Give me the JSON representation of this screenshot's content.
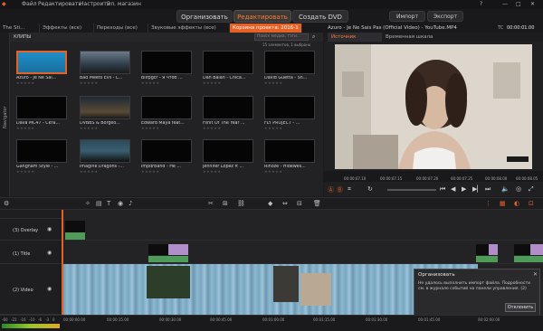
{
  "menu": [
    "Файл",
    "Редактировать",
    "Настроить",
    "Эл. магазин"
  ],
  "modes": {
    "organize": "Организовать",
    "edit": "Редактировать",
    "dvd": "Создать DVD"
  },
  "top_buttons": {
    "import": "Импорт",
    "export": "Экспорт"
  },
  "library": {
    "tabs": [
      "The Sti...",
      "Эффекты (все)",
      "Переходы (все)",
      "Звуковые эффекты (все)",
      "Корзина проекта: 2016-1"
    ],
    "side_label": "Navigator",
    "section": "КЛИПЫ",
    "search_placeholder": "Поиск медиа, тэги...",
    "count": "15 элементов, 1 выбрано",
    "items": [
      {
        "caption": "Azuro - Je Ne Sai...",
        "kind": "blue",
        "selected": true
      },
      {
        "caption": "Bad Meets Evil - L...",
        "kind": "scene1"
      },
      {
        "caption": "Bilfpgcr - Я чтоб ...",
        "kind": "dark"
      },
      {
        "caption": "Dan Balan - Chica...",
        "kind": "dark"
      },
      {
        "caption": "David Guetta - Sh...",
        "kind": "dark"
      },
      {
        "caption": "Dava MC47 - Ckra...",
        "kind": "dark"
      },
      {
        "caption": "DVBBS & Borgeo...",
        "kind": "scene2"
      },
      {
        "caption": "Edward Maya feat...",
        "kind": "dark"
      },
      {
        "caption": "Filnit Of The Year ...",
        "kind": "dark"
      },
      {
        "caption": "FLY PROJECT - ...",
        "kind": "dark"
      },
      {
        "caption": "Gangnam Style - ...",
        "kind": "dark"
      },
      {
        "caption": "Imagine Dragons -...",
        "kind": "scene3"
      },
      {
        "caption": "ImpdrBand - He ...",
        "kind": "dark"
      },
      {
        "caption": "Jennifer Lopez ft ...",
        "kind": "dark"
      },
      {
        "caption": "Rinoze - Hidewes...",
        "kind": "dark"
      }
    ]
  },
  "preview": {
    "title": "Azuro - Je Ne Sais Pas (Official Video) - YouTube.MP4",
    "tc_label": "TC",
    "timecode": "00:00:01.00",
    "tabs": [
      "Источник",
      "Временная шкала"
    ],
    "ruler": [
      "00:00:07.10",
      "00:00:07.15",
      "00:00:07.20",
      "00:00:07.25",
      "00:00:08.00",
      "00:00:08.05"
    ]
  },
  "tracks": [
    {
      "label": "(3) Overlay"
    },
    {
      "label": "(1) Title"
    },
    {
      "label": "(2) Video"
    }
  ],
  "notification": {
    "title": "Организовать",
    "text": "Не удалось выполнить импорт файла. Подробности см. в журнале событий на панели управления. (2)",
    "button": "Отклонить"
  },
  "timeline_ruler": [
    "00:00:00.00",
    "00:00:15.00",
    "00:00:30.00",
    "00:00:45.00",
    "00:01:00.00",
    "00:01:15.00",
    "00:01:30.00",
    "00:01:45.00",
    "00:02:00.00"
  ],
  "bottom_left": [
    "-60",
    "-22",
    "-16",
    "-10",
    "-6",
    "-3",
    "0"
  ],
  "colors": {
    "accent": "#e46225",
    "title_clip": "#b18ec9",
    "video_clip": "#7aa6c1",
    "audio_clip": "#4f9b58"
  }
}
